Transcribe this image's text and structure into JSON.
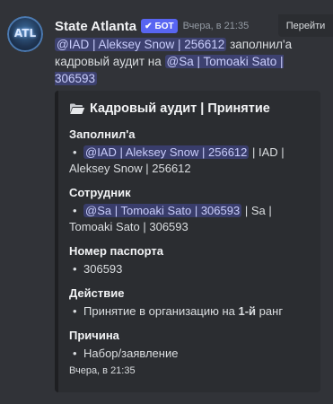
{
  "message": {
    "author": "State Atlanta",
    "bot_badge": "БОТ",
    "timestamp": "Вчера, в 21:35",
    "goto_label": "Перейти",
    "avatar_text": "ATL",
    "content": {
      "mention_1": "@IAD | Aleksey Snow | 256612",
      "text_1": " заполнил'а кадровый аудит на ",
      "mention_2": "@Sa | Tomoaki Sato | 306593"
    }
  },
  "embed": {
    "title": "Кадровый аудит | Принятие",
    "fields": [
      {
        "name": "Заполнил'а",
        "bullet": "•",
        "mention": "@IAD | Aleksey Snow | 256612",
        "text": " | IAD | Aleksey Snow | 256612"
      },
      {
        "name": "Сотрудник",
        "bullet": "•",
        "mention": "@Sa | Tomoaki Sato | 306593",
        "text": " | Sa | Tomoaki Sato | 306593"
      },
      {
        "name": "Номер паспорта",
        "bullet": "•",
        "text": "306593"
      },
      {
        "name": "Действие",
        "bullet": "•",
        "text_before": "Принятие в организацию на ",
        "bold": "1-й",
        "text_after": " ранг"
      },
      {
        "name": "Причина",
        "bullet": "•",
        "text": "Набор/заявление"
      }
    ],
    "footer": "Вчера, в 21:35"
  },
  "colors": {
    "background": "#313338",
    "embed_background": "#2b2d31",
    "bot_badge": "#5865f2",
    "mention_bg": "#3c4270",
    "mention_text": "#c9cdfb"
  }
}
